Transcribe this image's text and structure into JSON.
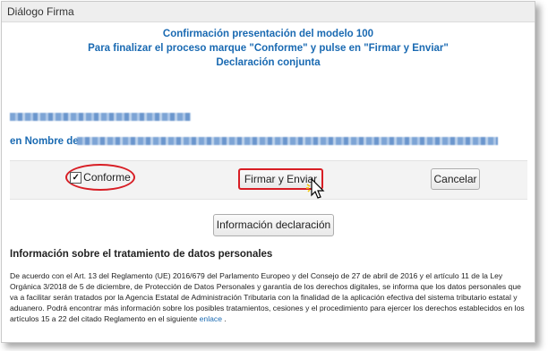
{
  "window": {
    "title": "Diálogo Firma"
  },
  "header": {
    "line1": "Confirmación presentación del modelo 100",
    "line2": "Para finalizar el proceso marque \"Conforme\" y pulse en \"Firmar y Enviar\"",
    "line3": "Declaración conjunta"
  },
  "taxpayer": {
    "nombre_label": "en Nombre de"
  },
  "actions": {
    "conforme_label": "Conforme",
    "conforme_checked": true,
    "firmar_label": "Firmar y Enviar",
    "cancelar_label": "Cancelar"
  },
  "info_button": {
    "label": "Información declaración"
  },
  "privacy": {
    "title": "Información sobre el tratamiento de datos personales",
    "text": "De acuerdo con el Art. 13 del Reglamento (UE) 2016/679 del Parlamento Europeo y del Consejo de 27 de abril de 2016 y el artículo 11 de la Ley Orgánica 3/2018 de 5 de diciembre, de Protección de Datos Personales y garantía de los derechos digitales, se informa que los datos personales que va a facilitar serán tratados por la Agencia Estatal de Administración Tributaria con la finalidad de la aplicación efectiva del sistema tributario estatal y aduanero. Podrá encontrar más información sobre los posibles tratamientos, cesiones y el procedimiento para ejercer los derechos establecidos en los artículos 15 a 22 del citado Reglamento en el siguiente",
    "link_label": "enlace",
    "end": "."
  },
  "colors": {
    "accent": "#1a6ab2",
    "highlight": "#d81e25"
  }
}
